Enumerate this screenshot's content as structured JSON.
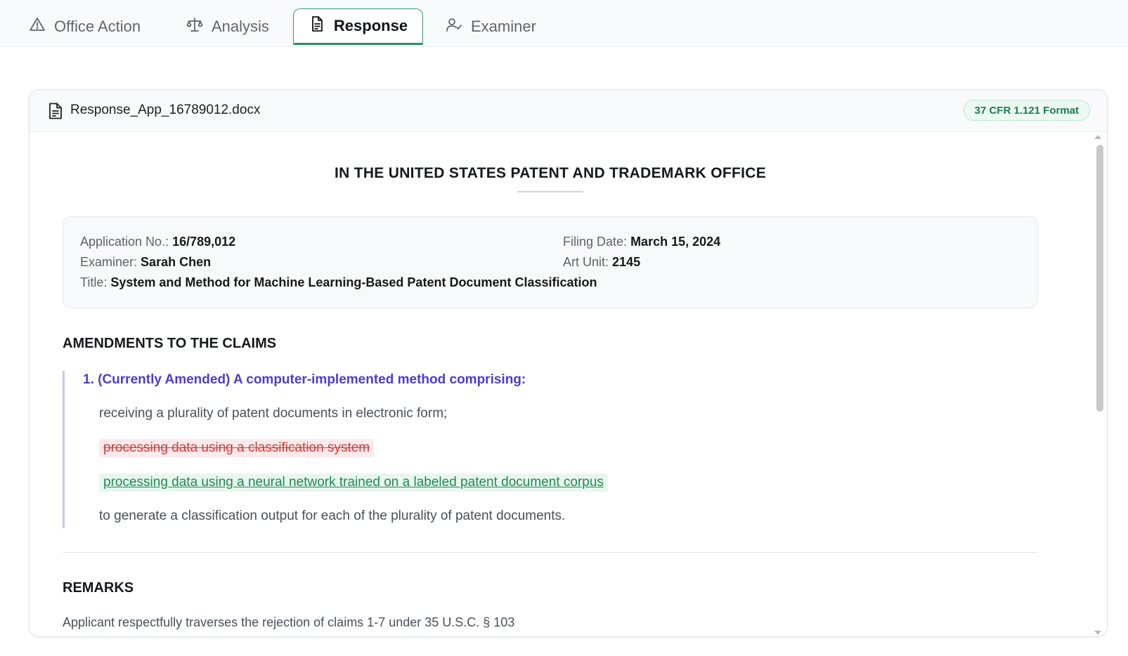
{
  "tabs": [
    {
      "label": "Office Action",
      "icon": "warning-triangle-icon"
    },
    {
      "label": "Analysis",
      "icon": "scale-icon"
    },
    {
      "label": "Response",
      "icon": "document-icon",
      "active": true
    },
    {
      "label": "Examiner",
      "icon": "user-check-icon"
    }
  ],
  "document": {
    "file_name": "Response_App_16789012.docx",
    "format_badge": "37 CFR 1.121 Format",
    "office_title": "IN THE UNITED STATES PATENT AND TRADEMARK OFFICE",
    "meta": {
      "application_label": "Application No.:",
      "application_value": "16/789,012",
      "filing_label": "Filing Date:",
      "filing_value": "March 15, 2024",
      "examiner_label": "Examiner:",
      "examiner_value": "Sarah Chen",
      "art_unit_label": "Art Unit:",
      "art_unit_value": "2145",
      "title_label": "Title:",
      "title_value": "System and Method for Machine Learning-Based Patent Document Classification"
    },
    "amendments_heading": "AMENDMENTS TO THE CLAIMS",
    "claim": {
      "heading": "1. (Currently Amended) A computer-implemented method comprising:",
      "line1": "receiving a plurality of patent documents in electronic form;",
      "deleted": "processing data using a classification system",
      "inserted": "processing data using a neural network trained on a labeled patent document corpus",
      "line4": "to generate a classification output for each of the plurality of patent documents."
    },
    "remarks_heading": "REMARKS",
    "remarks_partial": "Applicant respectfully traverses the rejection of claims 1-7 under 35 U.S.C. § 103"
  },
  "colors": {
    "active_tab_accent": "#2f8f5f",
    "claim_heading": "#4f3ad8",
    "deletion": "#d33b3b",
    "insertion": "#1f8a50"
  }
}
